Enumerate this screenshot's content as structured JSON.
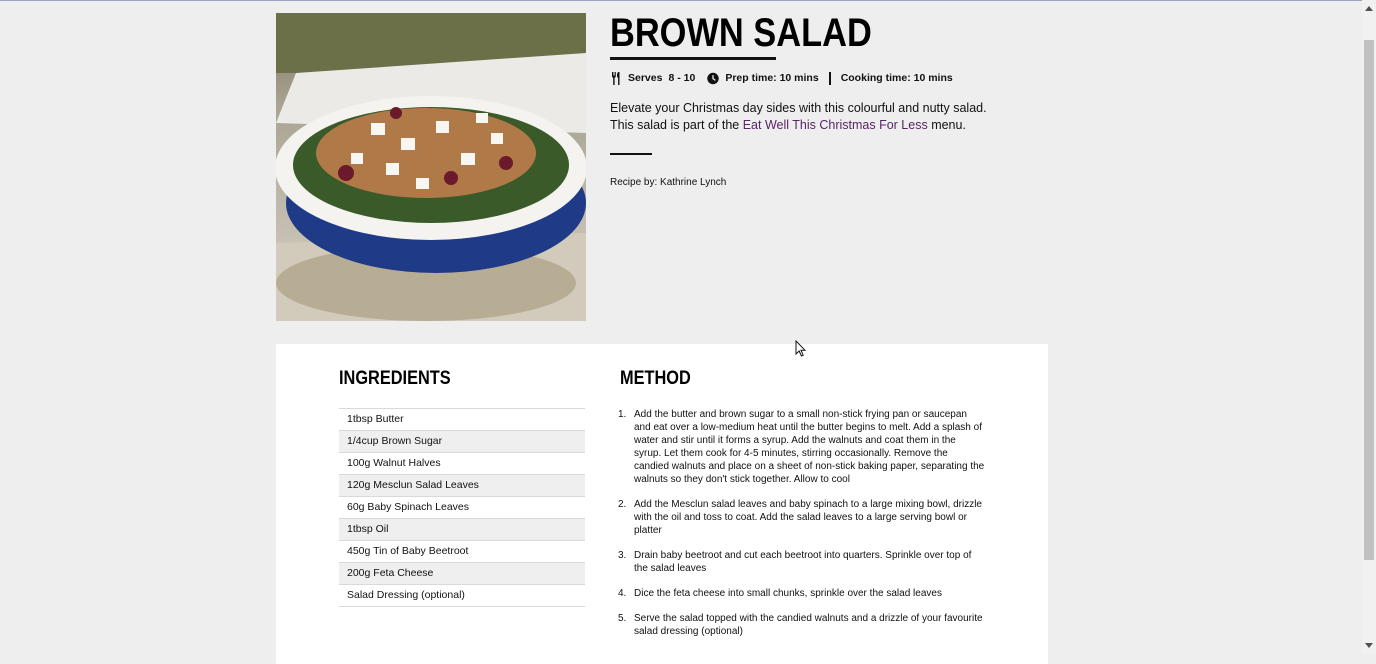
{
  "recipe": {
    "title": "BROWN SALAD",
    "serves_label": "Serves",
    "serves_value": "8 - 10",
    "prep_time": "Prep time: 10 mins",
    "cooking_time": "Cooking time: 10 mins",
    "intro_before_link": "Elevate your Christmas day sides with this colourful and nutty salad. This salad is part of the ",
    "intro_link": "Eat Well This Christmas For Less",
    "intro_after_link": " menu.",
    "byline": "Recipe by: Kathrine Lynch"
  },
  "ingredients": {
    "title": "INGREDIENTS",
    "items": [
      "1tbsp Butter",
      "1/4cup Brown Sugar",
      "100g Walnut Halves",
      "120g Mesclun Salad Leaves",
      "60g Baby Spinach Leaves",
      "1tbsp Oil",
      "450g Tin of Baby Beetroot",
      "200g Feta Cheese",
      "Salad Dressing (optional)"
    ]
  },
  "method": {
    "title": "METHOD",
    "steps": [
      {
        "num": "1.",
        "text": "Add the butter and brown sugar to a small non-stick frying pan or saucepan and eat over a low-medium heat until the butter begins to melt. Add a splash of water and stir until it forms a syrup. Add the walnuts and coat them in the syrup. Let them cook for 4-5 minutes, stirring occasionally. Remove the candied walnuts and place on a sheet of non-stick baking paper, separating the walnuts so they don't stick together. Allow to cool"
      },
      {
        "num": "2.",
        "text": "Add the Mesclun salad leaves and baby spinach to a large mixing bowl, drizzle with the oil and toss to coat. Add the salad leaves to a large serving bowl or platter"
      },
      {
        "num": "3.",
        "text": "Drain baby beetroot and cut each beetroot into quarters. Sprinkle over top of the salad leaves"
      },
      {
        "num": "4.",
        "text": "Dice the feta cheese into small chunks, sprinkle over the salad leaves"
      },
      {
        "num": "5.",
        "text": "Serve the salad topped with the candied walnuts and a drizzle of your favourite salad dressing (optional)"
      }
    ]
  },
  "icons": {
    "serves": "fork-knife-icon",
    "time": "clock-icon",
    "cursor": "mouse-cursor-icon"
  },
  "colors": {
    "background": "#eeeeee",
    "card": "#ffffff",
    "link": "#5b2466",
    "bowl": "#2a4a9a"
  }
}
